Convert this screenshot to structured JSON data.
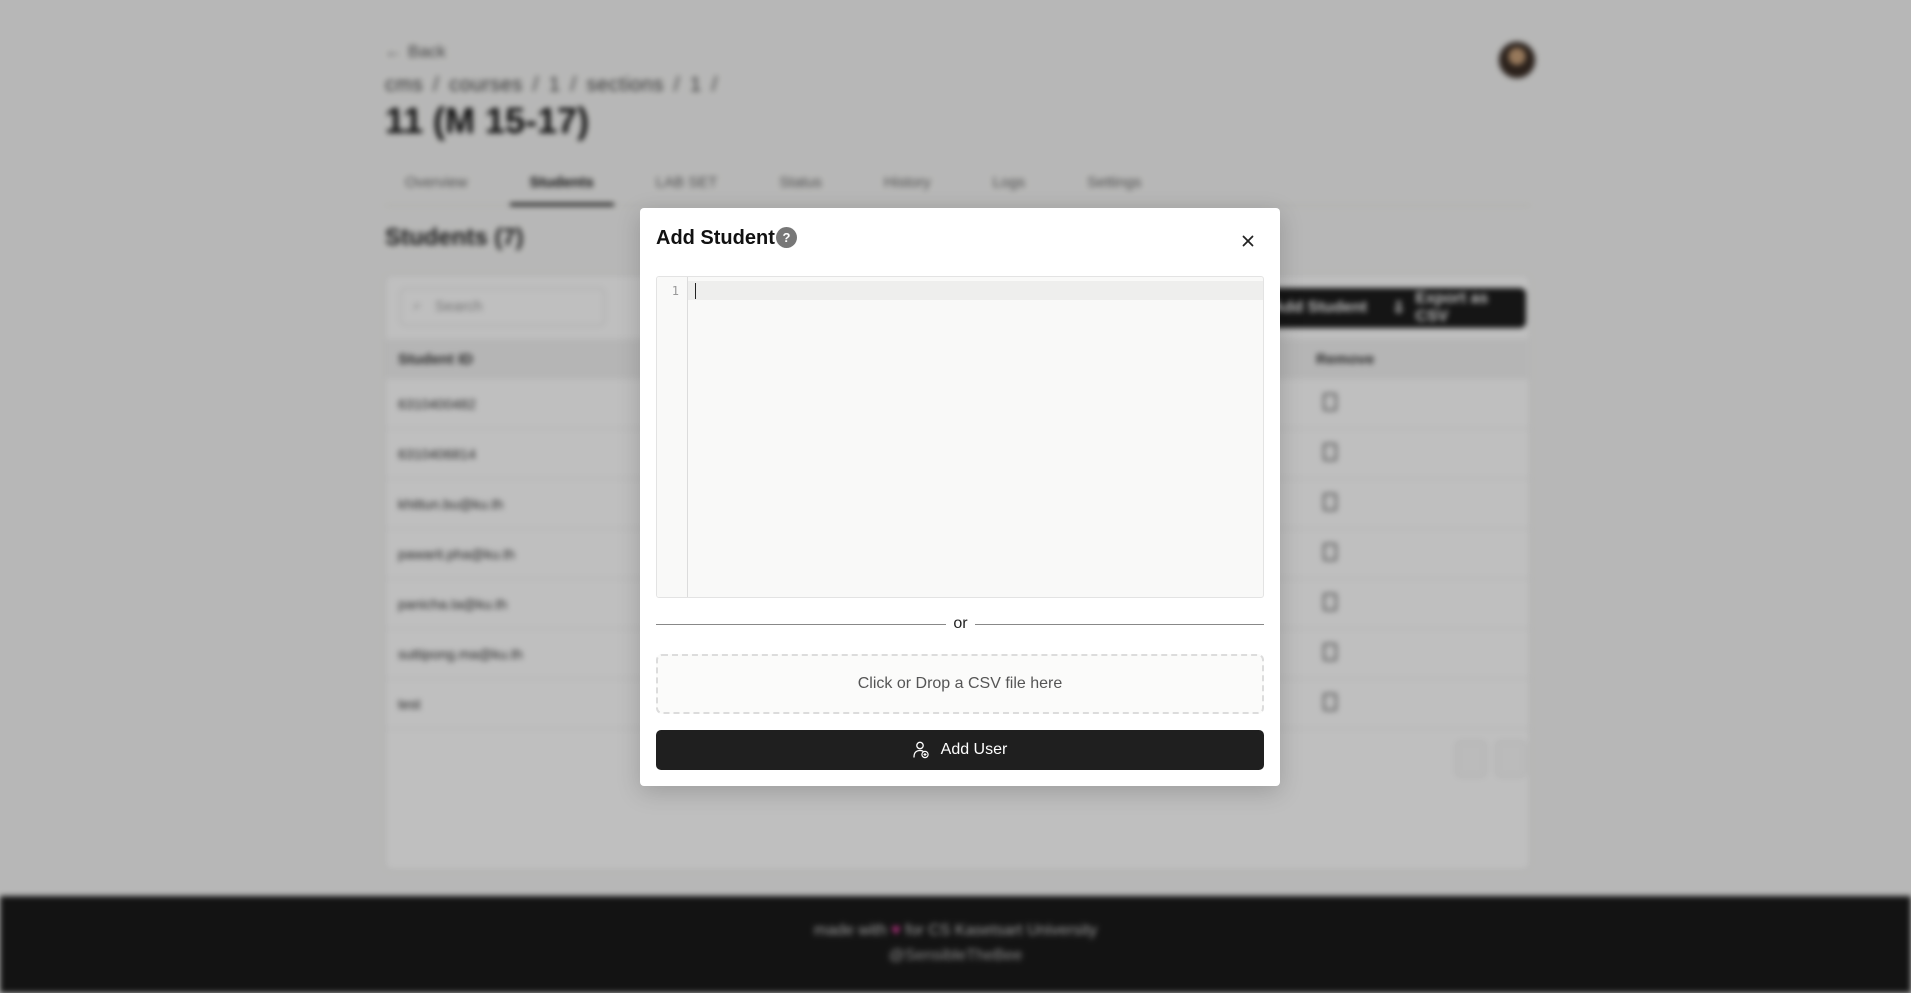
{
  "page": {
    "back_label": "Back",
    "breadcrumb": [
      "cms",
      "/",
      "courses",
      "/",
      "1",
      "/",
      "sections",
      "/",
      "1",
      "/"
    ],
    "title": "11 (M 15-17)",
    "tabs": [
      "Overview",
      "Students",
      "LAB SET",
      "Status",
      "History",
      "Logs",
      "Settings"
    ],
    "active_tab": "Students",
    "section_title": "Students (7)",
    "search_placeholder": "Search",
    "add_student_label": "Add Student",
    "export_label": "Export as CSV",
    "columns": [
      "Student ID",
      "Remove"
    ],
    "students": [
      "6310400482",
      "6310406814",
      "khittun.bu@ku.th",
      "pawarit.pha@ku.th",
      "panicha.ta@ku.th",
      "suttipong.ma@ku.th",
      "test"
    ]
  },
  "footer": {
    "line1_prefix": "made with",
    "heart": "♥",
    "line1_suffix": "for CS Kasetsart University",
    "line2": "@SensibleTheBee"
  },
  "modal": {
    "title": "Add Student",
    "help": "?",
    "editor": {
      "line_number": "1",
      "value": ""
    },
    "divider_text": "or",
    "dropzone_text": "Click or Drop a CSV file here",
    "submit_label": "Add User"
  },
  "colors": {
    "primary_button": "#1f1f1f",
    "overlay": "rgba(0,0,0,0.25)",
    "heart": "#e040a0"
  },
  "icons": {
    "help": "help-circle-icon",
    "close": "close-icon",
    "submit": "user-add-icon"
  }
}
